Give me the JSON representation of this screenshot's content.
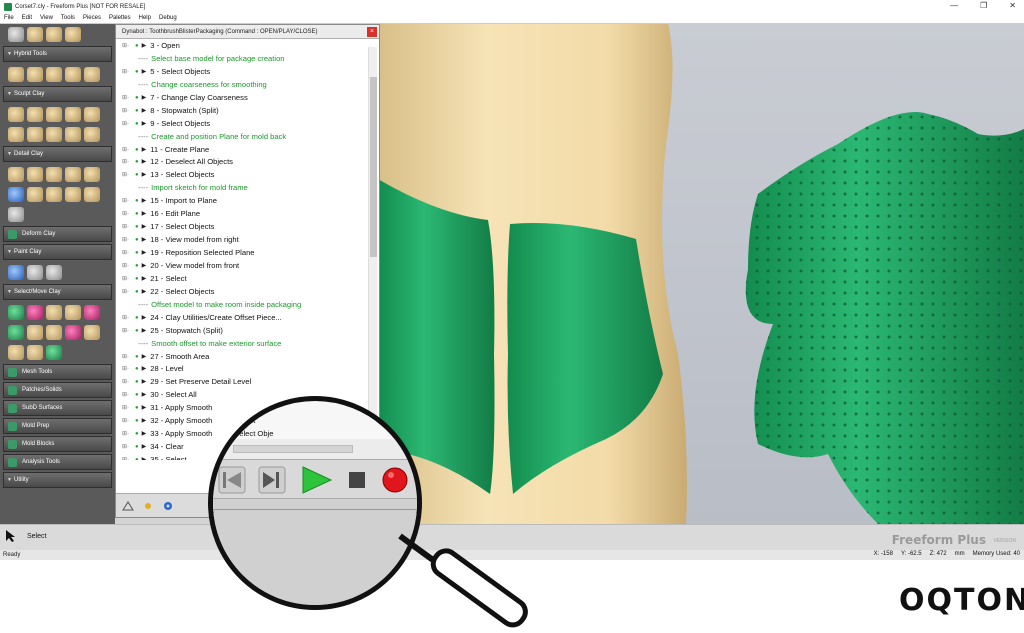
{
  "window": {
    "title": "Corset7.cly - Freeform Plus [NOT FOR RESALE]",
    "controls": [
      "—",
      "❐",
      "✕"
    ]
  },
  "menu": [
    "File",
    "Edit",
    "View",
    "Tools",
    "Pieces",
    "Palettes",
    "Help",
    "Debug"
  ],
  "palette": {
    "sections": [
      {
        "label": "Hybrid Tools"
      },
      {
        "label": "Sculpt Clay"
      },
      {
        "label": "Detail Clay"
      },
      {
        "label": "Deform Clay"
      },
      {
        "label": "Paint Clay"
      },
      {
        "label": "Select/Move Clay"
      },
      {
        "label": "Mesh Tools"
      },
      {
        "label": "Patches/Solids"
      },
      {
        "label": "SubD Surfaces"
      },
      {
        "label": "Mold Prep"
      },
      {
        "label": "Mold Blocks"
      },
      {
        "label": "Analysis Tools"
      },
      {
        "label": "Utility"
      }
    ]
  },
  "dynabot": {
    "title": "Dynabot : ToothbrushBlisterPackaging (Command : OPEN/PLAY/CLOSE)",
    "close": "×",
    "steps": [
      {
        "kind": "cmd",
        "text": "3 - Open"
      },
      {
        "kind": "comment",
        "text": "Select base model for package creation"
      },
      {
        "kind": "cmd",
        "text": "5 - Select Objects"
      },
      {
        "kind": "comment",
        "text": "Change coarseness for smoothing"
      },
      {
        "kind": "cmd",
        "text": "7 - Change Clay Coarseness"
      },
      {
        "kind": "cmd",
        "text": "8 - Stopwatch (Split)"
      },
      {
        "kind": "cmd",
        "text": "9 - Select Objects"
      },
      {
        "kind": "comment",
        "text": "Create and position Plane for mold back"
      },
      {
        "kind": "cmd",
        "text": "11 - Create Plane"
      },
      {
        "kind": "cmd",
        "text": "12 - Deselect All Objects"
      },
      {
        "kind": "cmd",
        "text": "13 - Select Objects"
      },
      {
        "kind": "comment",
        "text": "Import sketch for mold frame"
      },
      {
        "kind": "cmd",
        "text": "15 - Import to Plane"
      },
      {
        "kind": "cmd",
        "text": "16 - Edit Plane"
      },
      {
        "kind": "cmd",
        "text": "17 - Select Objects"
      },
      {
        "kind": "cmd",
        "text": "18 - View model from right"
      },
      {
        "kind": "cmd",
        "text": "19 - Reposition Selected Plane"
      },
      {
        "kind": "cmd",
        "text": "20 - View model from front"
      },
      {
        "kind": "cmd",
        "text": "21 - Select"
      },
      {
        "kind": "cmd",
        "text": "22 - Select Objects"
      },
      {
        "kind": "comment",
        "text": "Offset model to make room inside packaging"
      },
      {
        "kind": "cmd",
        "text": "24 - Clay Utilities/Create Offset Piece..."
      },
      {
        "kind": "cmd",
        "text": "25 - Stopwatch (Split)"
      },
      {
        "kind": "comment",
        "text": "Smooth offset to make exterior surface"
      },
      {
        "kind": "cmd",
        "text": "27 - Smooth Area"
      },
      {
        "kind": "cmd",
        "text": "28 - Level"
      },
      {
        "kind": "cmd",
        "text": "29 - Set Preserve Detail Level"
      },
      {
        "kind": "cmd",
        "text": "30 - Select All"
      },
      {
        "kind": "cmd",
        "text": "31 - Apply Smooth"
      },
      {
        "kind": "cmd",
        "text": "32 - Apply Smooth"
      },
      {
        "kind": "cmd",
        "text": "33 - Apply Smooth"
      },
      {
        "kind": "cmd",
        "text": "34 - Clear"
      },
      {
        "kind": "cmd",
        "text": "35 - Select"
      },
      {
        "kind": "cmd",
        "text": "36 - Select Obje"
      }
    ]
  },
  "magnified": {
    "rows": [
      "34 - Clear",
      "35 - Select",
      "36 - Select Obje"
    ],
    "controls": [
      "step-back",
      "step-forward",
      "play",
      "stop",
      "record"
    ]
  },
  "bottom": {
    "tool_label": "Select",
    "brand": "Freeform Plus",
    "brand_sub": "VERSION"
  },
  "status": {
    "left": "Ready",
    "x": "X: -158",
    "y": "Y: -62.5",
    "z": "Z: 472",
    "units": "mm",
    "memory": "Memory Used: 40"
  },
  "logo": "OQTON",
  "colors": {
    "accent_green": "#1f9a5a",
    "model_green": "#23a065",
    "skin": "#f1dcaa",
    "record_red": "#e0161c",
    "play_green": "#2cc43a"
  }
}
